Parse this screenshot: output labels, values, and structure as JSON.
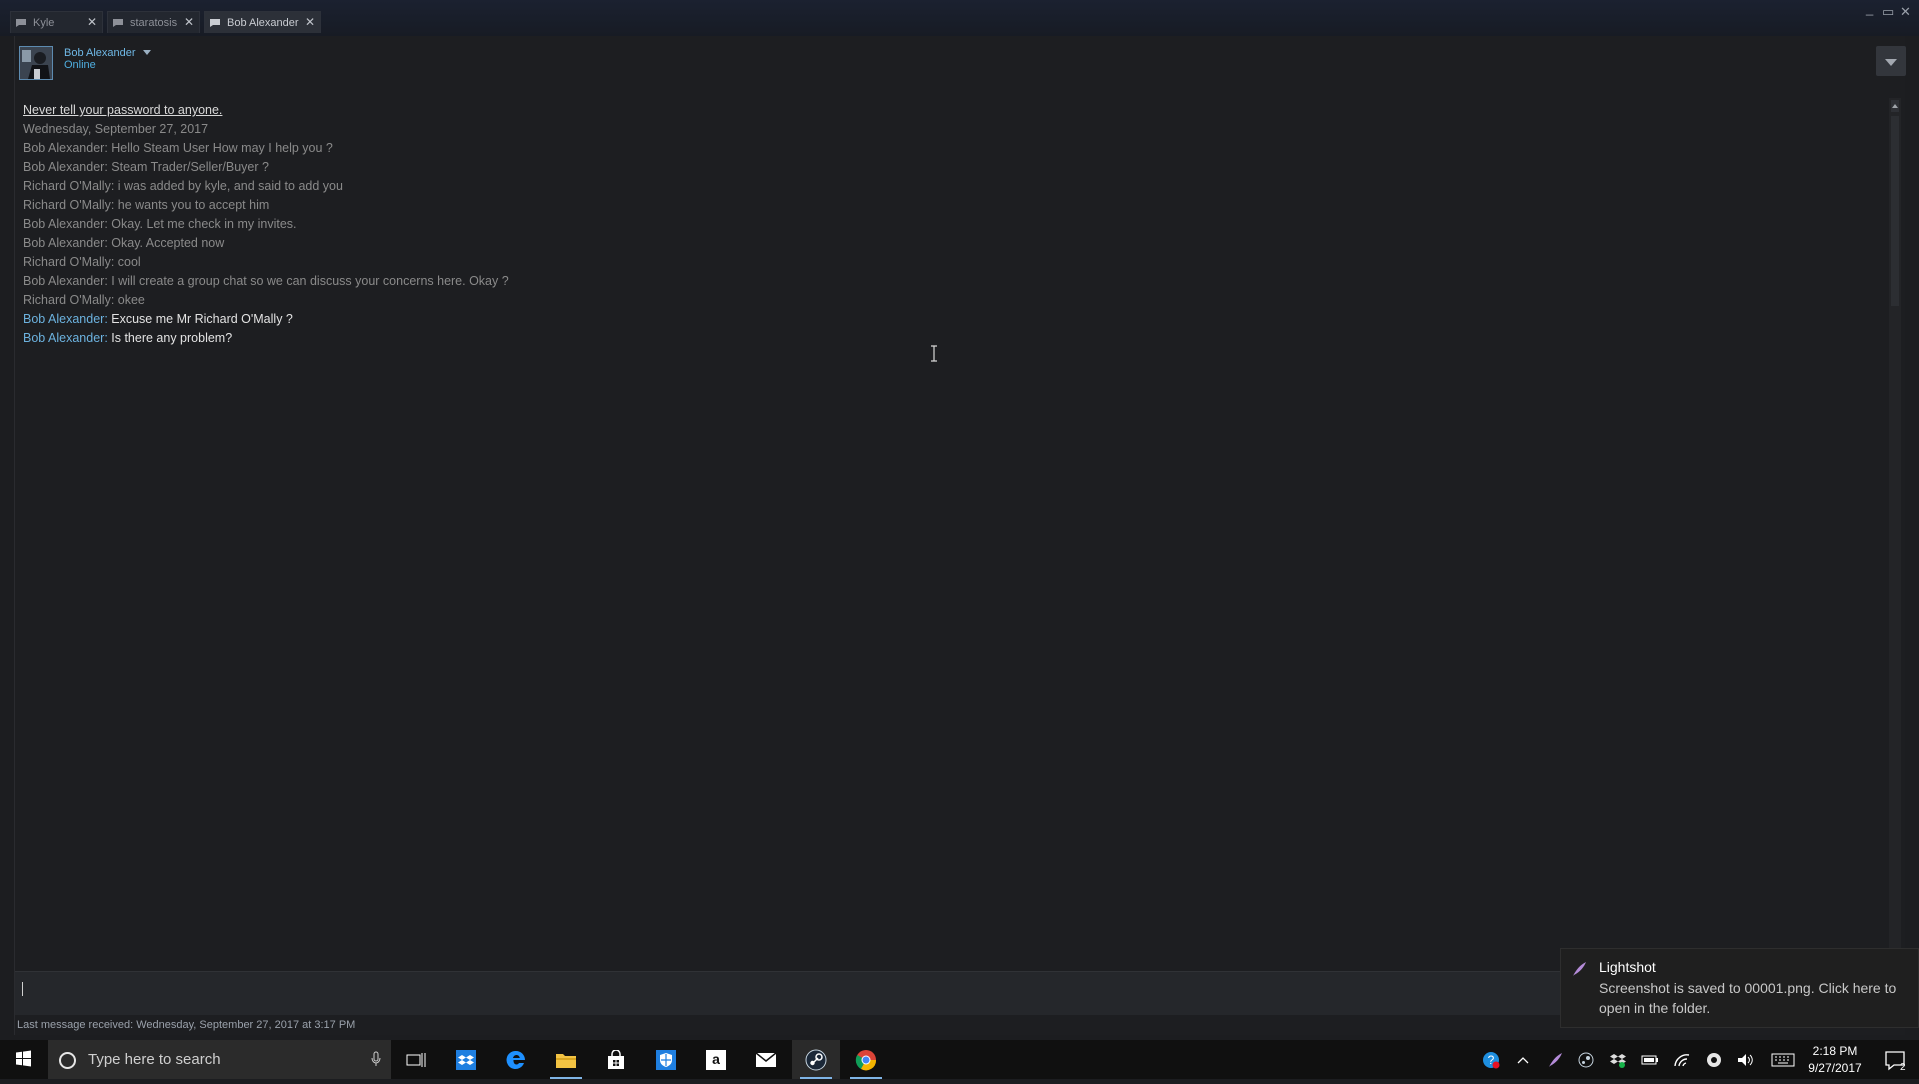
{
  "window": {
    "tabs": [
      {
        "label": "Kyle",
        "active": false
      },
      {
        "label": "staratosis",
        "active": false
      },
      {
        "label": "Bob Alexander",
        "active": true
      }
    ],
    "controls": {
      "minimize": "_",
      "maximize": "▭",
      "close": "✕"
    }
  },
  "chat": {
    "friend_name": "Bob Alexander",
    "friend_status": "Online",
    "warning": "Never tell your password to anyone.",
    "date": "Wednesday, September 27, 2017",
    "messages": [
      {
        "sender": "Bob Alexander",
        "text": "Hello Steam User How may I help you ?"
      },
      {
        "sender": "Bob Alexander",
        "text": "Steam Trader/Seller/Buyer ?"
      },
      {
        "sender": "Richard O'Mally",
        "text": "i was added by kyle, and said to add you"
      },
      {
        "sender": "Richard O'Mally",
        "text": "he wants you to accept him"
      },
      {
        "sender": "Bob Alexander",
        "text": "Okay. Let me check in my invites."
      },
      {
        "sender": "Bob Alexander",
        "text": "Okay. Accepted now"
      },
      {
        "sender": "Richard O'Mally",
        "text": "cool"
      },
      {
        "sender": "Bob Alexander",
        "text": "I will create a group chat so we can discuss your concerns here. Okay ?"
      },
      {
        "sender": "Richard O'Mally",
        "text": "okee"
      },
      {
        "sender": "Bob Alexander",
        "text": "Excuse me Mr Richard O'Mally ?"
      },
      {
        "sender": "Bob Alexander",
        "text": "Is there any problem?"
      }
    ],
    "input_value": "",
    "last_message": "Last message received: Wednesday, September 27, 2017 at 3:17 PM"
  },
  "toast": {
    "app": "Lightshot",
    "body": "Screenshot is saved to 00001.png. Click here to open in the folder."
  },
  "taskbar": {
    "search_placeholder": "Type here to search",
    "pinned": [
      "task-view-icon",
      "dropbox-icon",
      "edge-icon",
      "file-explorer-icon",
      "store-icon",
      "security-shield-icon",
      "amazon-icon",
      "mail-icon",
      "steam-icon",
      "chrome-icon"
    ],
    "amazon_glyph": "a",
    "tray": [
      "help-icon",
      "chevron-up-icon",
      "lightshot-icon",
      "steam-tray-icon",
      "dropbox-tray-icon",
      "battery-icon",
      "wifi-icon",
      "steam-sync-icon",
      "volume-icon",
      "keyboard-icon"
    ],
    "clock_time": "2:18 PM",
    "clock_date": "9/27/2017",
    "notification_count": "2"
  },
  "colors": {
    "accent_blue": "#6cb2df",
    "status_online": "#4faee0",
    "background": "#1c1d20"
  }
}
